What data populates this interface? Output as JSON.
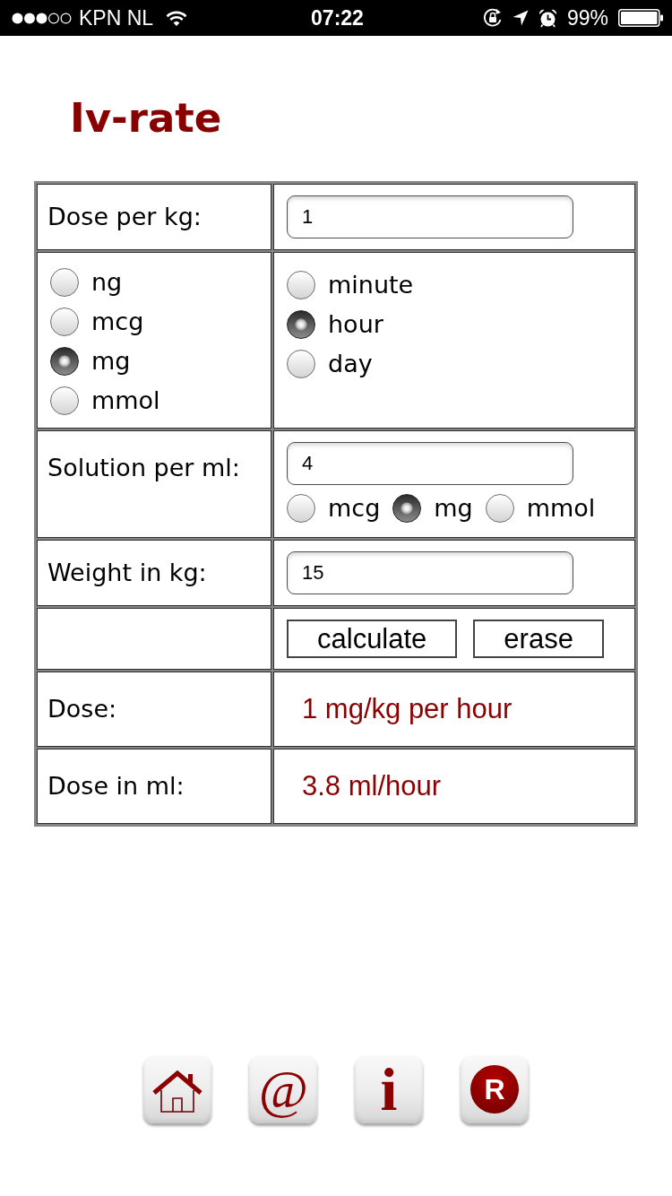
{
  "status_bar": {
    "carrier": "KPN NL",
    "time": "07:22",
    "battery": "99%"
  },
  "title": "Iv-rate",
  "form": {
    "rows": [
      {
        "kind": "input",
        "label": "Dose per kg:",
        "value": "1"
      },
      {
        "kind": "radio_columns",
        "columns": [
          {
            "options": [
              {
                "label": "ng",
                "selected": false
              },
              {
                "label": "mcg",
                "selected": false
              },
              {
                "label": "mg",
                "selected": true
              },
              {
                "label": "mmol",
                "selected": false
              }
            ]
          },
          {
            "options": [
              {
                "label": "minute",
                "selected": false
              },
              {
                "label": "hour",
                "selected": true
              },
              {
                "label": "day",
                "selected": false
              }
            ]
          }
        ]
      },
      {
        "kind": "input_radios",
        "label": "Solution per ml:",
        "value": "4",
        "options": [
          {
            "label": "mcg",
            "selected": false
          },
          {
            "label": "mg",
            "selected": true
          },
          {
            "label": "mmol",
            "selected": false
          }
        ]
      },
      {
        "kind": "input",
        "label": "Weight in kg:",
        "value": "15"
      },
      {
        "kind": "buttons",
        "buttons": [
          {
            "label": "calculate"
          },
          {
            "label": "erase"
          }
        ]
      },
      {
        "kind": "result",
        "label": "Dose:",
        "value": "1 mg/kg per hour"
      },
      {
        "kind": "result",
        "label": "Dose in ml:",
        "value": "3.8 ml/hour"
      }
    ]
  },
  "nav": [
    {
      "kind": "home"
    },
    {
      "kind": "at",
      "glyph": "@"
    },
    {
      "kind": "info",
      "glyph": "i"
    },
    {
      "kind": "disc",
      "glyph": "R"
    }
  ]
}
